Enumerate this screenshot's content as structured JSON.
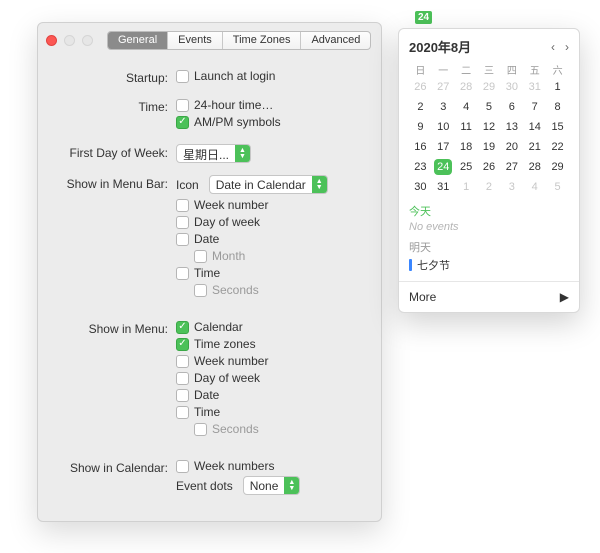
{
  "tabs": [
    "General",
    "Events",
    "Time Zones",
    "Advanced"
  ],
  "labels": {
    "startup": "Startup:",
    "time": "Time:",
    "firstday": "First Day of Week:",
    "menubar": "Show in Menu Bar:",
    "menu": "Show in Menu:",
    "calendar": "Show in Calendar:"
  },
  "startup": {
    "launch": "Launch at login"
  },
  "time": {
    "tf": "24-hour time…",
    "ampm": "AM/PM symbols"
  },
  "firstday_value": "星期日...",
  "menubar": {
    "icon_label": "Icon",
    "icon_value": "Date in Calendar",
    "weeknum": "Week number",
    "dow": "Day of week",
    "date": "Date",
    "month": "Month",
    "timechk": "Time",
    "seconds": "Seconds"
  },
  "menu": {
    "cal": "Calendar",
    "tz": "Time zones",
    "weeknum": "Week number",
    "dow": "Day of week",
    "date": "Date",
    "timechk": "Time",
    "seconds": "Seconds"
  },
  "calendar": {
    "weeknums": "Week numbers",
    "dots_label": "Event dots",
    "dots_value": "None"
  },
  "menubar_badge": "24",
  "popover": {
    "title": "2020年8月",
    "weekdays": [
      "日",
      "一",
      "二",
      "三",
      "四",
      "五",
      "六"
    ],
    "grid": [
      {
        "n": "26",
        "m": true
      },
      {
        "n": "27",
        "m": true
      },
      {
        "n": "28",
        "m": true
      },
      {
        "n": "29",
        "m": true
      },
      {
        "n": "30",
        "m": true
      },
      {
        "n": "31",
        "m": true
      },
      {
        "n": "1"
      },
      {
        "n": "2"
      },
      {
        "n": "3"
      },
      {
        "n": "4"
      },
      {
        "n": "5"
      },
      {
        "n": "6"
      },
      {
        "n": "7"
      },
      {
        "n": "8"
      },
      {
        "n": "9"
      },
      {
        "n": "10"
      },
      {
        "n": "11"
      },
      {
        "n": "12"
      },
      {
        "n": "13"
      },
      {
        "n": "14"
      },
      {
        "n": "15"
      },
      {
        "n": "16"
      },
      {
        "n": "17"
      },
      {
        "n": "18"
      },
      {
        "n": "19"
      },
      {
        "n": "20"
      },
      {
        "n": "21"
      },
      {
        "n": "22"
      },
      {
        "n": "23"
      },
      {
        "n": "24",
        "sel": true
      },
      {
        "n": "25"
      },
      {
        "n": "26"
      },
      {
        "n": "27"
      },
      {
        "n": "28"
      },
      {
        "n": "29"
      },
      {
        "n": "30"
      },
      {
        "n": "31"
      },
      {
        "n": "1",
        "m": true
      },
      {
        "n": "2",
        "m": true
      },
      {
        "n": "3",
        "m": true
      },
      {
        "n": "4",
        "m": true
      },
      {
        "n": "5",
        "m": true
      }
    ],
    "today_label": "今天",
    "no_events": "No events",
    "tomorrow_label": "明天",
    "event": "七夕节",
    "more": "More"
  }
}
